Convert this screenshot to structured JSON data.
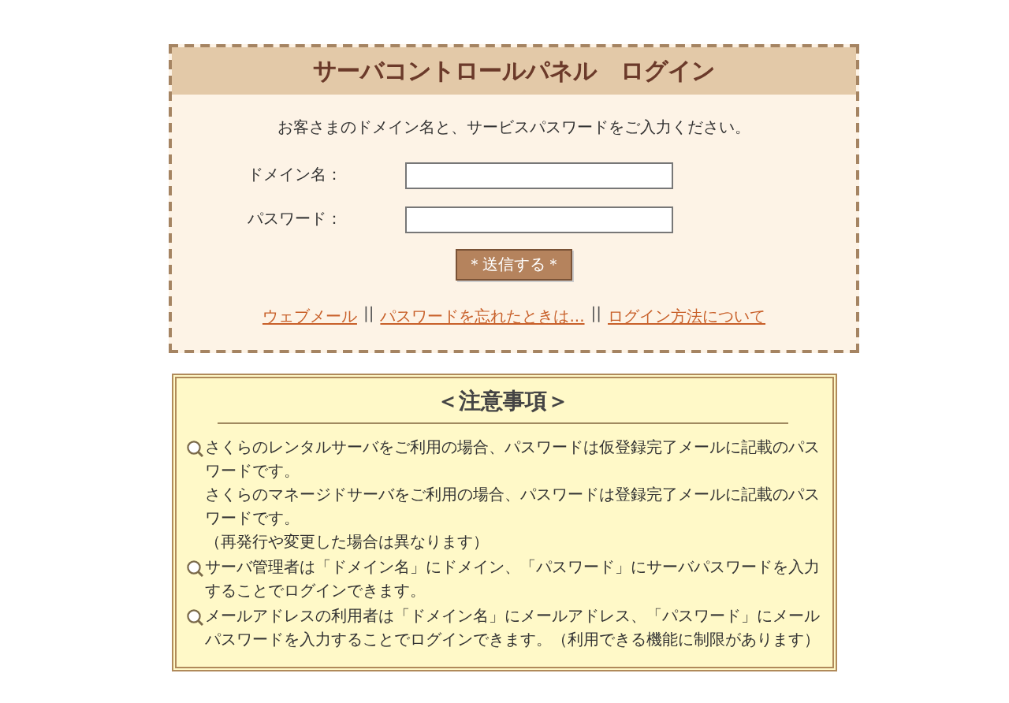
{
  "login": {
    "title": "サーバコントロールパネル　ログイン",
    "instruction": "お客さまのドメイン名と、サービスパスワードをご入力ください。",
    "fields": [
      {
        "label": "ドメイン名："
      },
      {
        "label": "パスワード："
      }
    ],
    "submit": "＊送信する＊",
    "links": [
      {
        "label": "ウェブメール"
      },
      {
        "label": "パスワードを忘れたときは..."
      },
      {
        "label": "ログイン方法について"
      }
    ],
    "separator": "||"
  },
  "notes": {
    "title": "＜注意事項＞",
    "items": [
      {
        "paragraphs": [
          "さくらのレンタルサーバをご利用の場合、パスワードは仮登録完了メールに記載のパスワードです。",
          "さくらのマネージドサーバをご利用の場合、パスワードは登録完了メールに記載のパスワードです。",
          "（再発行や変更した場合は異なります）"
        ]
      },
      {
        "paragraphs": [
          "サーバ管理者は「ドメイン名」にドメイン、「パスワード」にサーバパスワードを入力することでログインできます。"
        ]
      },
      {
        "paragraphs": [
          "メールアドレスの利用者は「ドメイン名」にメールアドレス、「パスワード」にメールパスワードを入力することでログインできます。（利用できる機能に制限があります）"
        ]
      }
    ]
  }
}
